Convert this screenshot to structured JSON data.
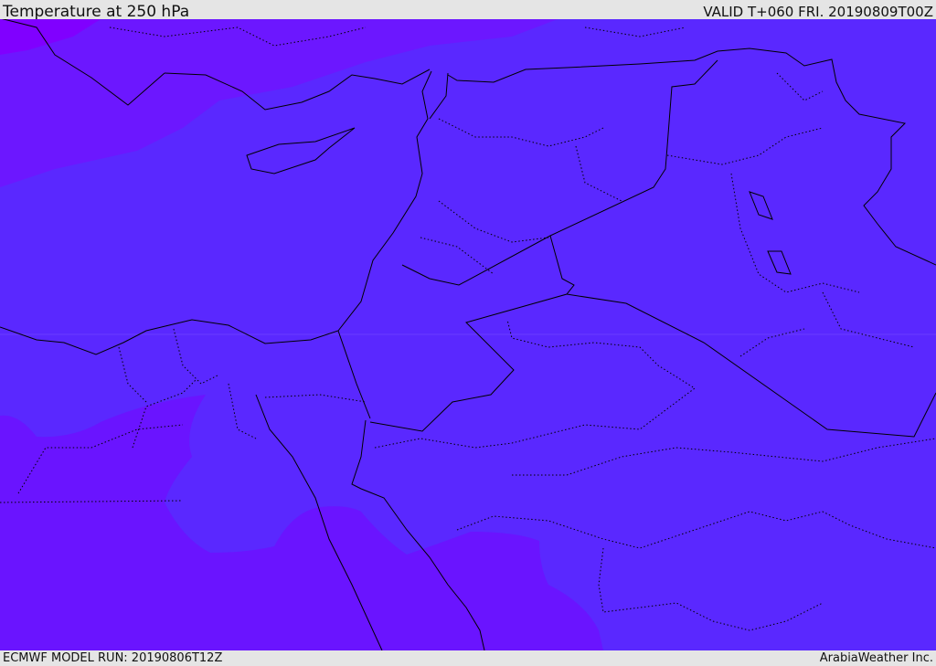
{
  "header": {
    "title": "Temperature at 250 hPa",
    "valid": "VALID T+060 FRI. 20190809T00Z"
  },
  "footer": {
    "model_run": "ECMWF MODEL RUN: 20190806T12Z",
    "brand": "ArabiaWeather Inc."
  },
  "colors": {
    "base_field": "#5a28ff",
    "cold_band": "#6c17ff",
    "coldest_corner": "#8000ff",
    "warm_south": "#6a14ff",
    "coastline": "#000000",
    "header_bg": "#e5e5e5"
  }
}
